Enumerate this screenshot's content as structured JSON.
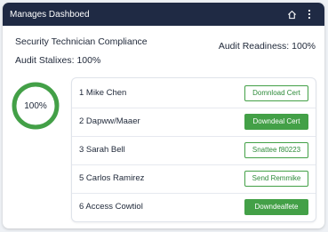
{
  "header": {
    "title": "Manages Dashboed",
    "home_icon": "home-icon",
    "menu_icon": "more-vert-icon"
  },
  "section": {
    "title": "Security Technician Compliance",
    "audit_status": "Audit Stalixes: 100%",
    "audit_readiness": "Audit Readiness: 100%"
  },
  "progress": {
    "label": "100%",
    "value": 1.0,
    "color": "#43a047"
  },
  "items": [
    {
      "label": "1  Mike Chen",
      "button": "Domnload Cert",
      "style": "outline"
    },
    {
      "label": "2  Dapww/Maaer",
      "button": "Downdeal Cert",
      "style": "filled"
    },
    {
      "label": "3  Sarah Bell",
      "button": "Snattee f80223",
      "style": "outline"
    },
    {
      "label": "5  Carlos Ramirez",
      "button": "Send Remmike",
      "style": "outline"
    },
    {
      "label": "6  Access Cowtiol",
      "button": "Downdealfete",
      "style": "filled"
    }
  ],
  "colors": {
    "header_bg": "#1f2a44",
    "accent": "#43a047"
  }
}
